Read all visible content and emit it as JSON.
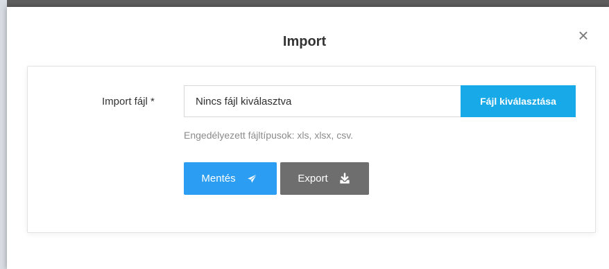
{
  "modal": {
    "title": "Import",
    "close_label": "×"
  },
  "form": {
    "field_label": "Import fájl *",
    "file_input": {
      "value": "Nincs fájl kiválasztva"
    },
    "choose_button": "Fájl kiválasztása",
    "helper_text": "Engedélyezett fájltípusok: xls, xlsx, csv."
  },
  "actions": {
    "save_label": "Mentés",
    "export_label": "Export",
    "save_icon": "paper-plane-icon",
    "export_icon": "download-icon"
  },
  "colors": {
    "accent_blue": "#17a9e8",
    "save_blue": "#2b9df2",
    "export_gray": "#6e6e6e"
  }
}
